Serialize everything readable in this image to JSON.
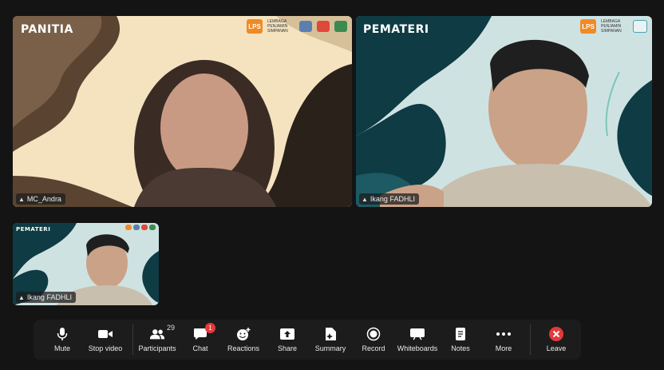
{
  "tiles": [
    {
      "tag": "PANITIA",
      "name": "MC_Andra"
    },
    {
      "tag": "PEMATERI",
      "name": "Ikang FADHLI"
    },
    {
      "tag": "PEMATERI",
      "name": "Ikang FADHLI"
    }
  ],
  "logo": {
    "mark": "LPS",
    "text": "LEMBAGA PENJAMIN SIMPANAN"
  },
  "toolbar": {
    "mute": "Mute",
    "stop_video": "Stop video",
    "participants": "Participants",
    "participants_count": "29",
    "chat": "Chat",
    "chat_badge": "1",
    "reactions": "Reactions",
    "share": "Share",
    "summary": "Summary",
    "record": "Record",
    "whiteboards": "Whiteboards",
    "notes": "Notes",
    "more": "More",
    "leave": "Leave"
  },
  "colors": {
    "active_border": "#3fd35f",
    "leave": "#e5393b",
    "badge": "#e5393b"
  }
}
